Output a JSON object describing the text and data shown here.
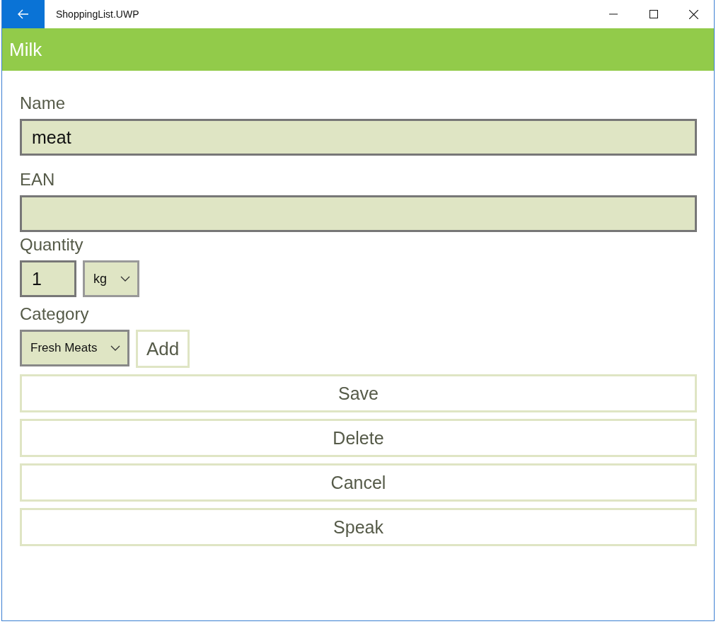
{
  "window": {
    "title": "ShoppingList.UWP"
  },
  "header": {
    "title": "Milk"
  },
  "fields": [
    {
      "kind": "text",
      "label": "Name",
      "value": "meat"
    },
    {
      "kind": "text",
      "label": "EAN"
    }
  ],
  "quantity": {
    "label": "Quantity",
    "value": "1",
    "unit": "kg"
  },
  "category": {
    "label": "Category",
    "value": "Fresh Meats",
    "add_button": "Add"
  },
  "buttons": [
    "Save",
    "Delete",
    "Cancel",
    "Speak"
  ]
}
